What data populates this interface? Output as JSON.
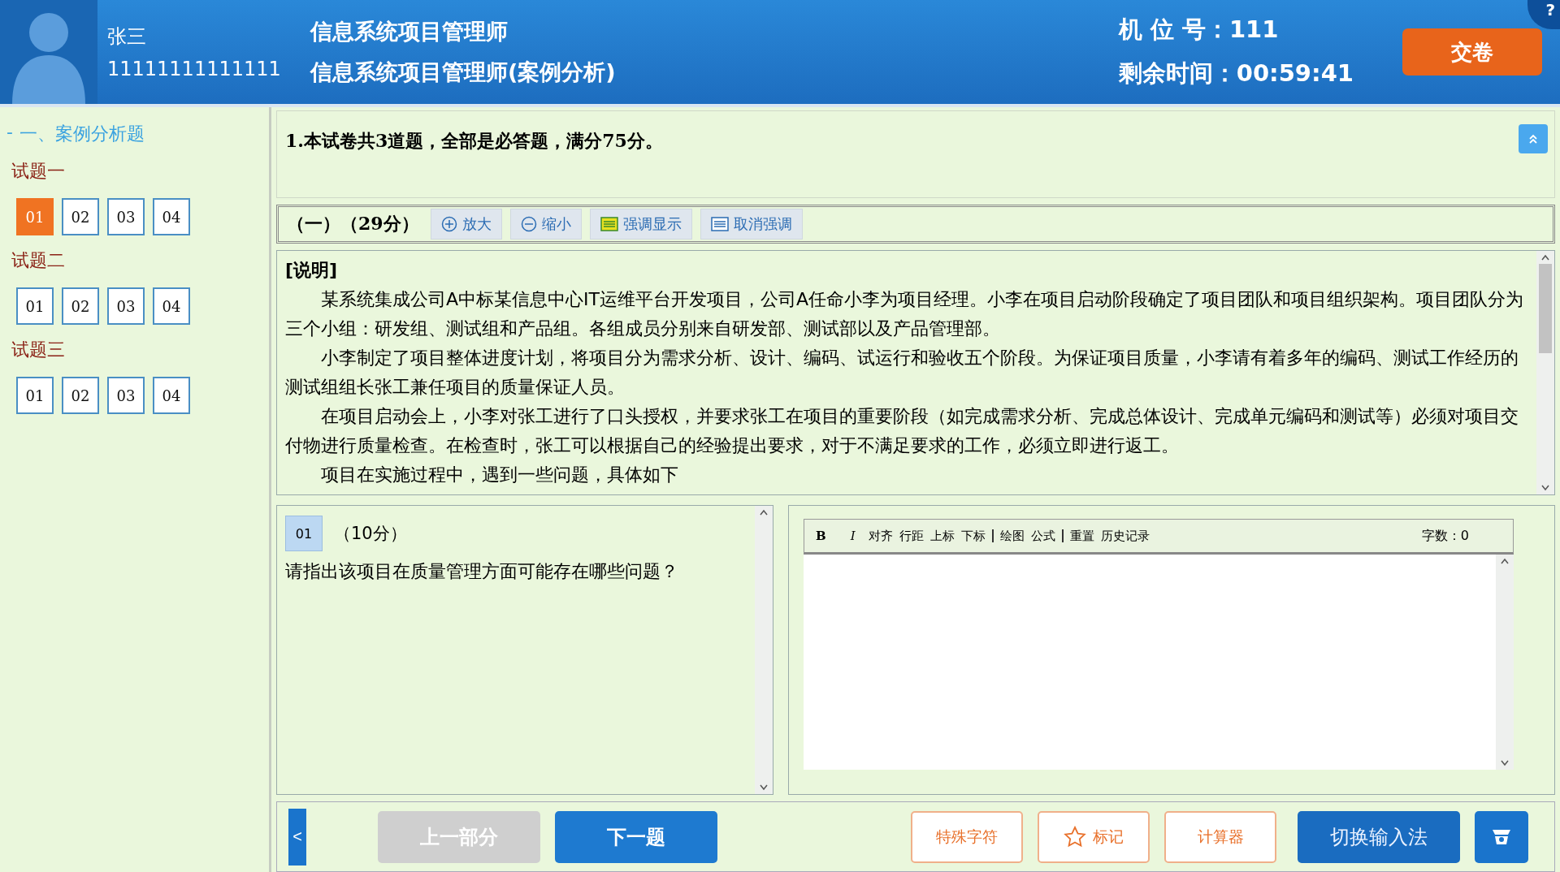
{
  "header": {
    "user_name": "张三",
    "user_id": "11111111111111",
    "exam_title": "信息系统项目管理师",
    "exam_subtitle": "信息系统项目管理师(案例分析)",
    "seat": "机 位 号：111",
    "time_left": "剩余时间：00:59:41",
    "submit": "交卷",
    "help": "?"
  },
  "sidebar": {
    "toggle": "-",
    "section": "一、案例分析题",
    "groups": [
      {
        "title": "试题一",
        "items": [
          {
            "label": "01",
            "selected": true
          },
          {
            "label": "02",
            "selected": false
          },
          {
            "label": "03",
            "selected": false
          },
          {
            "label": "04",
            "selected": false
          }
        ]
      },
      {
        "title": "试题二",
        "items": [
          {
            "label": "01",
            "selected": false
          },
          {
            "label": "02",
            "selected": false
          },
          {
            "label": "03",
            "selected": false
          },
          {
            "label": "04",
            "selected": false
          }
        ]
      },
      {
        "title": "试题三",
        "items": [
          {
            "label": "01",
            "selected": false
          },
          {
            "label": "02",
            "selected": false
          },
          {
            "label": "03",
            "selected": false
          },
          {
            "label": "04",
            "selected": false
          }
        ]
      }
    ]
  },
  "notice": "1.本试卷共3道题，全部是必答题，满分75分。",
  "part": {
    "heading": "（一）（29分）",
    "tools": [
      {
        "kind": "zoom_in",
        "label": "放大"
      },
      {
        "kind": "zoom_out",
        "label": "缩小"
      },
      {
        "kind": "highlight",
        "label": "强调显示"
      },
      {
        "kind": "unhighlight",
        "label": "取消强调"
      }
    ]
  },
  "passage": {
    "title": "[说明]",
    "paragraphs": [
      "某系统集成公司A中标某信息中心IT运维平台开发项目，公司A任命小李为项目经理。小李在项目启动阶段确定了项目团队和项目组织架构。项目团队分为三个小组：研发组、测试组和产品组。各组成员分别来自研发部、测试部以及产品管理部。",
      "小李制定了项目整体进度计划，将项目分为需求分析、设计、编码、试运行和验收五个阶段。为保证项目质量，小李请有着多年的编码、测试工作经历的测试组组长张工兼任项目的质量保证人员。",
      "在项目启动会上，小李对张工进行了口头授权，并要求张工在项目的重要阶段（如完成需求分析、完成总体设计、完成单元编码和测试等）必须对项目交付物进行质量检查。在检查时，张工可以根据自己的经验提出要求，对于不满足要求的工作，必须立即进行返工。",
      "项目在实施过程中，遇到一些问题，具体如下"
    ]
  },
  "question": {
    "number": "01",
    "score": "（10分）",
    "text": "请指出该项目在质量管理方面可能存在哪些问题？"
  },
  "editor": {
    "tool_groups": [
      [
        {
          "kind": "bold",
          "label": "B"
        },
        {
          "kind": "italic",
          "label": "I"
        },
        {
          "kind": "text",
          "label": "对齐"
        },
        {
          "kind": "text",
          "label": "行距"
        },
        {
          "kind": "text",
          "label": "上标"
        },
        {
          "kind": "text",
          "label": "下标"
        }
      ],
      [
        {
          "kind": "text",
          "label": "绘图"
        },
        {
          "kind": "text",
          "label": "公式"
        }
      ],
      [
        {
          "kind": "text",
          "label": "重置"
        },
        {
          "kind": "text",
          "label": "历史记录"
        }
      ]
    ],
    "word_count": "字数：0"
  },
  "footer": {
    "collapse": "<",
    "buttons": [
      {
        "kind": "nav",
        "label": "上一部分",
        "disabled": true
      },
      {
        "kind": "nav",
        "label": "下一题",
        "disabled": false
      },
      {
        "kind": "outline",
        "label": "特殊字符"
      },
      {
        "kind": "star",
        "label": "标记"
      },
      {
        "kind": "outline",
        "label": "计算器"
      },
      {
        "kind": "dark",
        "label": "切换输入法"
      },
      {
        "kind": "icon"
      }
    ]
  }
}
